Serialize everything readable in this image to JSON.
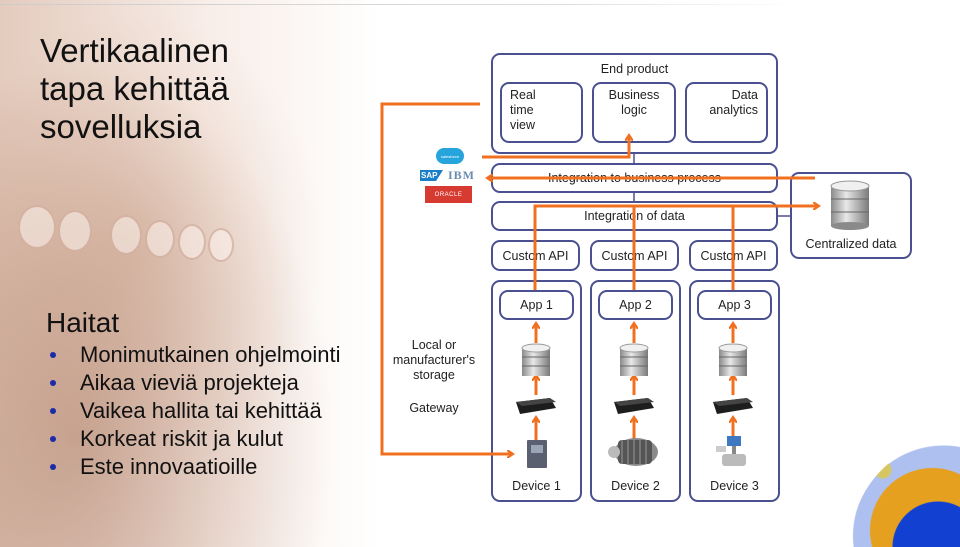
{
  "slide": {
    "title_lines": [
      "Vertikaalinen",
      "tapa kehittää",
      "sovelluksia"
    ],
    "disadvantages_heading": "Haitat",
    "disadvantages": [
      "Monimutkainen ohjelmointi",
      "Aikaa vieviä projekteja",
      "Vaikea hallita tai kehittää",
      "Korkeat riskit ja kulut",
      "Este innovaatioille"
    ]
  },
  "diagram": {
    "end_product": {
      "label": "End product",
      "modules": [
        "Real\ntime\nview",
        "Business\nlogic",
        "Data\nanalytics"
      ]
    },
    "integration_business": "Integration to business process",
    "integration_data": "Integration of data",
    "custom_apis": [
      "Custom API",
      "Custom API",
      "Custom API"
    ],
    "apps": [
      "App 1",
      "App 2",
      "App 3"
    ],
    "devices": [
      "Device 1",
      "Device 2",
      "Device 3"
    ],
    "centralized_data": "Centralized data",
    "side_labels": {
      "storage": "Local or\nmanufacturer's\nstorage",
      "gateway": "Gateway"
    },
    "logos": {
      "salesforce": "salesforce",
      "sap": "SAP",
      "ibm": "IBM",
      "oracle": "ORACLE"
    },
    "colors": {
      "arrow": "#f07020",
      "box_border": "#4a5090",
      "bullet": "#1a2aa8"
    }
  }
}
